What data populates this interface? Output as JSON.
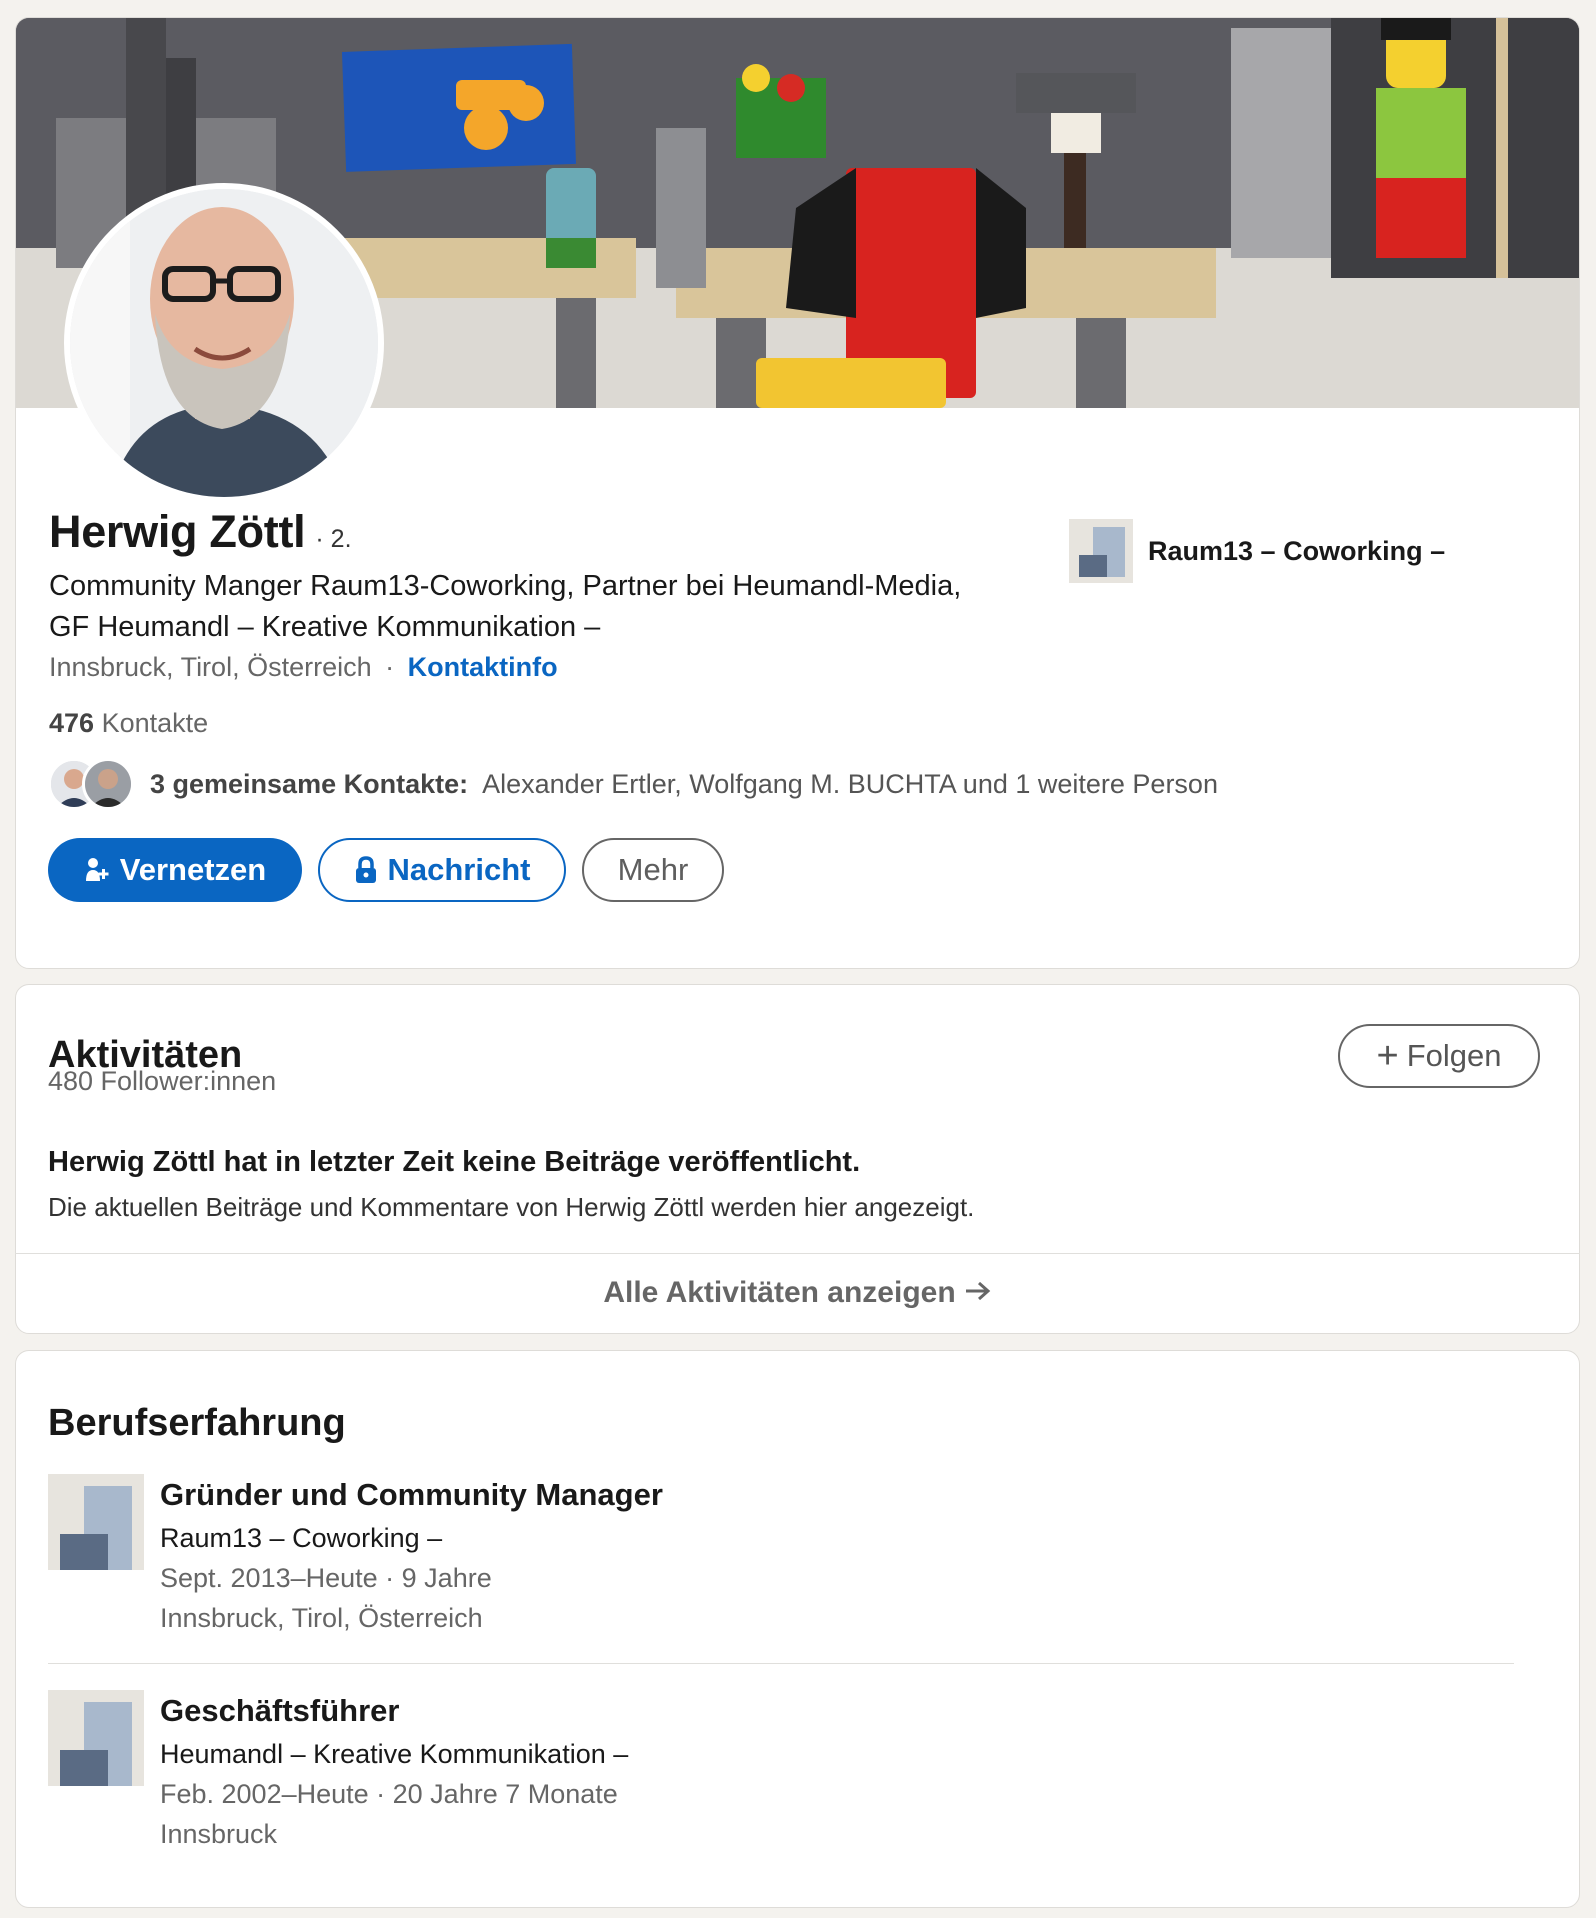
{
  "profile": {
    "name": "Herwig Zöttl",
    "degree": "· 2.",
    "headline": "Community Manger Raum13-Coworking, Partner bei Heumandl-Media, GF Heumandl – Kreative Kommunikation –",
    "location": "Innsbruck, Tirol, Österreich",
    "location_separator": "·",
    "contact_info_link": "Kontaktinfo",
    "contacts_count": "476",
    "contacts_label": "Kontakte",
    "mutual_label": "3 gemeinsame Kontakte:",
    "mutual_names": "Alexander Ertler, Wolfgang M. BUCHTA und 1 weitere Person",
    "current_company": "Raum13 – Coworking –"
  },
  "actions": {
    "connect": "Vernetzen",
    "message": "Nachricht",
    "more": "Mehr",
    "connect_icon": "add-person-icon",
    "message_icon": "lock-icon"
  },
  "activity": {
    "title": "Aktivitäten",
    "followers": "480 Follower:innen",
    "follow_button": "Folgen",
    "follow_icon": "plus-icon",
    "empty_title": "Herwig Zöttl hat in letzter Zeit keine Beiträge veröffentlicht.",
    "empty_text": "Die aktuellen Beiträge und Kommentare von Herwig Zöttl werden hier angezeigt.",
    "show_all": "Alle Aktivitäten anzeigen",
    "show_all_icon": "arrow-right-icon"
  },
  "experience": {
    "title": "Berufserfahrung",
    "items": [
      {
        "role": "Gründer und Community Manager",
        "company": "Raum13 – Coworking –",
        "dates": "Sept. 2013–Heute · 9 Jahre",
        "location": "Innsbruck, Tirol, Österreich"
      },
      {
        "role": "Geschäftsführer",
        "company": "Heumandl – Kreative Kommunikation –",
        "dates": "Feb. 2002–Heute · 20 Jahre 7 Monate",
        "location": "Innsbruck"
      }
    ]
  },
  "colors": {
    "primary": "#0a66c2",
    "page_background": "#f4f2ee",
    "card_background": "#ffffff",
    "secondary_text": "#666666"
  }
}
